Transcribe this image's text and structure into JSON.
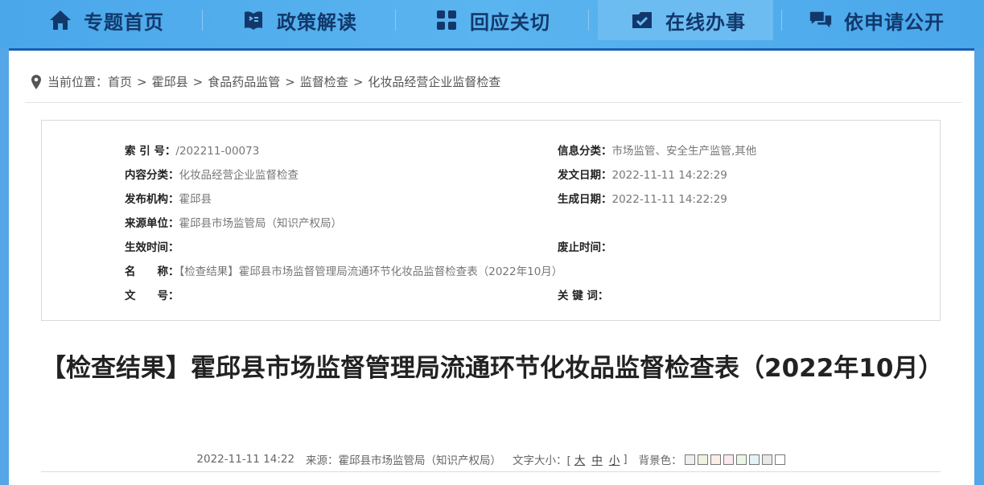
{
  "nav": {
    "items": [
      {
        "label": "专题首页",
        "icon": "home-icon"
      },
      {
        "label": "政策解读",
        "icon": "book-icon"
      },
      {
        "label": "回应关切",
        "icon": "grid-icon"
      },
      {
        "label": "在线办事",
        "icon": "briefcase-check-icon"
      },
      {
        "label": "依申请公开",
        "icon": "chat-icon"
      }
    ]
  },
  "breadcrumb": {
    "prefix": "当前位置：",
    "items": [
      "首页",
      "霍邱县",
      "食品药品监管",
      "监督检查",
      "化妆品经营企业监督检查"
    ],
    "separator": ">"
  },
  "meta": {
    "index_label": "索 引 号：",
    "index_value": "/202211-00073",
    "category_label": "信息分类：",
    "category_value": "市场监管、安全生产监管,其他",
    "content_label": "内容分类：",
    "content_value": "化妆品经营企业监督检查",
    "issue_date_label": "发文日期：",
    "issue_date_value": "2022-11-11 14:22:29",
    "org_label": "发布机构：",
    "org_value": "霍邱县",
    "gen_date_label": "生成日期：",
    "gen_date_value": "2022-11-11 14:22:29",
    "source_label": "来源单位：",
    "source_value": "霍邱县市场监管局（知识产权局）",
    "effective_label": "生效时间：",
    "effective_value": "",
    "expire_label": "废止时间：",
    "expire_value": "",
    "name_label": "名　　称：",
    "name_value": "【检查结果】霍邱县市场监督管理局流通环节化妆品监督检查表（2022年10月）",
    "docno_label": "文　　号：",
    "docno_value": "",
    "keywords_label": "关 键 词：",
    "keywords_value": ""
  },
  "article": {
    "title": "【检查结果】霍邱县市场监督管理局流通环节化妆品监督检查表（2022年10月）",
    "date": "2022-11-11 14:22",
    "source": "来源：霍邱县市场监管局（知识产权局）",
    "font_size_label": "文字大小：[",
    "font_size_close": "]",
    "font_sizes": [
      "大",
      "中",
      "小"
    ],
    "bg_label": "背景色：",
    "bg_colors": [
      "#efefef",
      "#f1f1e2",
      "#fdeee4",
      "#fbe8ef",
      "#eaf7e6",
      "#e4f3f6",
      "#e8e8e8",
      "#ffffff"
    ]
  }
}
